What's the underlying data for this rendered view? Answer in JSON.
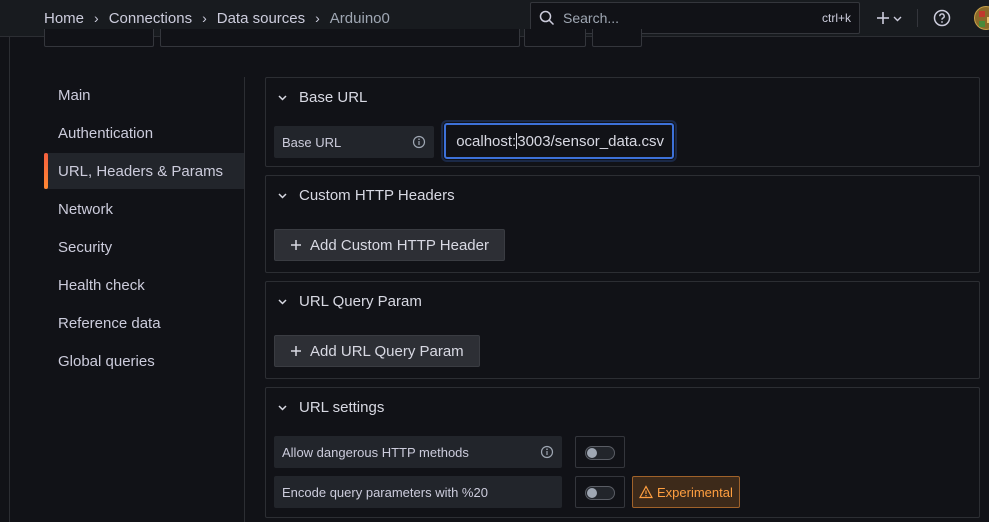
{
  "breadcrumb": {
    "items": [
      "Home",
      "Connections",
      "Data sources"
    ],
    "current": "Arduino0"
  },
  "search": {
    "placeholder": "Search...",
    "shortcut": "ctrl+k"
  },
  "sidenav": {
    "items": [
      {
        "label": "Main"
      },
      {
        "label": "Authentication"
      },
      {
        "label": "URL, Headers & Params",
        "active": true
      },
      {
        "label": "Network"
      },
      {
        "label": "Security"
      },
      {
        "label": "Health check"
      },
      {
        "label": "Reference data"
      },
      {
        "label": "Global queries"
      }
    ]
  },
  "sections": {
    "base_url": {
      "title": "Base URL",
      "field_label": "Base URL",
      "value_before_caret": "ocalhost:",
      "value_after_caret": "3003/sensor_data.csv"
    },
    "headers": {
      "title": "Custom HTTP Headers",
      "button": "Add Custom HTTP Header"
    },
    "query": {
      "title": "URL Query Param",
      "button": "Add URL Query Param"
    },
    "settings": {
      "title": "URL settings",
      "dangerous_label": "Allow dangerous HTTP methods",
      "dangerous_enabled": false,
      "encode_label": "Encode query parameters with %20",
      "encode_enabled": false,
      "badge": "Experimental"
    }
  },
  "colors": {
    "accent": "#3d71d9",
    "active_bar": "#f55f3e",
    "warning": "#ff9f40"
  }
}
